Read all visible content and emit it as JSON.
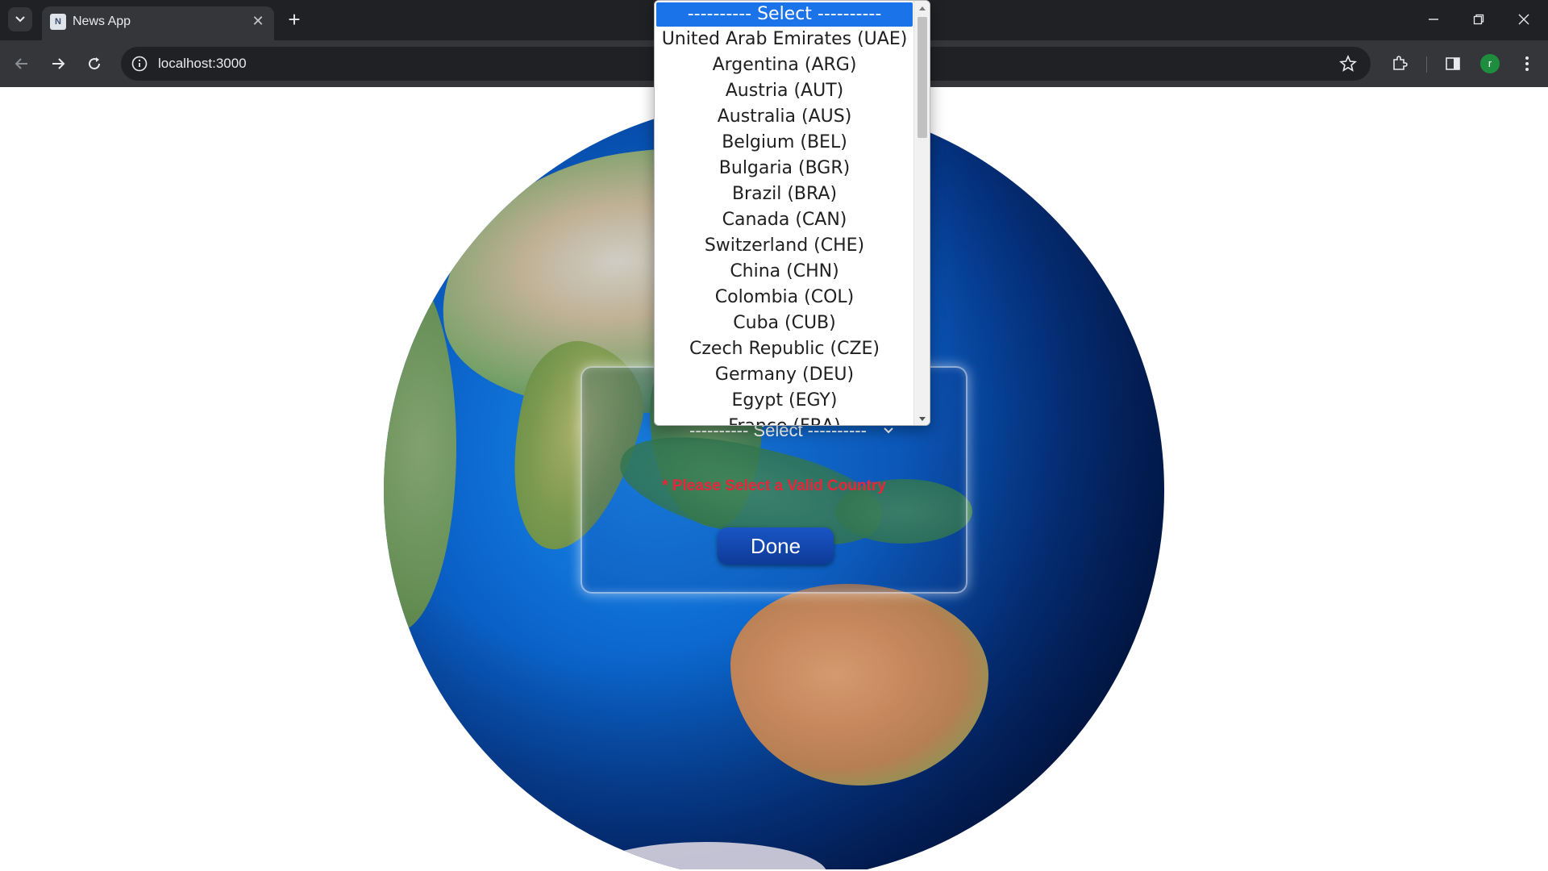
{
  "browser": {
    "tab_title": "News App",
    "tab_favicon": "N",
    "url": "localhost:3000",
    "profile_initial": "r"
  },
  "icons": {
    "tab_list": "chevron-down-icon",
    "tab_close": "close-icon",
    "new_tab": "plus-icon",
    "back": "arrow-left-icon",
    "forward": "arrow-right-icon",
    "reload": "reload-icon",
    "site_info": "info-icon",
    "bookmark": "star-icon",
    "extensions": "puzzle-icon",
    "side_panel": "side-panel-icon",
    "menu": "kebab-menu-icon"
  },
  "form": {
    "select_value": "---------- Select ----------",
    "error": "* Please Select a Valid Country",
    "done_label": "Done"
  },
  "dropdown": {
    "options": [
      "---------- Select ----------",
      "United Arab Emirates (UAE)",
      "Argentina (ARG)",
      "Austria (AUT)",
      "Australia (AUS)",
      "Belgium (BEL)",
      "Bulgaria (BGR)",
      "Brazil (BRA)",
      "Canada (CAN)",
      "Switzerland (CHE)",
      "China (CHN)",
      "Colombia (COL)",
      "Cuba (CUB)",
      "Czech Republic (CZE)",
      "Germany (DEU)",
      "Egypt (EGY)",
      "France (FRA)"
    ]
  },
  "colors": {
    "error": "#e8253a",
    "selected_option": "#1a73e8",
    "done_button": "#1a55c4"
  }
}
